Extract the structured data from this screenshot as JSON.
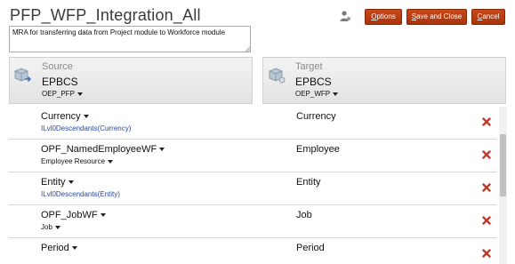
{
  "header": {
    "title": "PFP_WFP_Integration_All",
    "options_first": "O",
    "options_rest": "ptions",
    "save_first": "S",
    "save_rest": "ave and Close",
    "cancel_first": "C",
    "cancel_rest": "ancel"
  },
  "description": {
    "value": "MRA for transferring data from Project module to Workforce module"
  },
  "source": {
    "label": "Source",
    "app": "EPBCS",
    "cube": "OEP_PFP"
  },
  "target": {
    "label": "Target",
    "app": "EPBCS",
    "cube": "OEP_WFP"
  },
  "rows": [
    {
      "source_dim": "Currency",
      "source_member": "ILvl0Descendants(Currency)",
      "target_dim": "Currency"
    },
    {
      "source_dim": "OPF_NamedEmployeeWF",
      "source_member": "Employee Resource",
      "target_dim": "Employee"
    },
    {
      "source_dim": "Entity",
      "source_member": "ILvl0Descendants(Entity)",
      "target_dim": "Entity"
    },
    {
      "source_dim": "OPF_JobWF",
      "source_member": "Job",
      "target_dim": "Job"
    },
    {
      "source_dim": "Period",
      "source_member": "",
      "target_dim": "Period"
    }
  ],
  "icons": {
    "user": "person-icon",
    "delete": "delete-x-icon",
    "cube": "cube-icon"
  },
  "colors": {
    "button": "#b43c12",
    "delete": "#c0392b",
    "link": "#2a48a8"
  }
}
